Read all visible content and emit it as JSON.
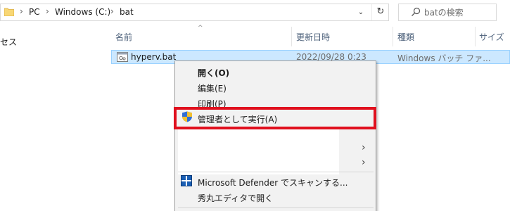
{
  "address_bar": {
    "breadcrumbs": [
      "PC",
      "Windows (C:)",
      "bat"
    ],
    "separator": "›",
    "dropdown_glyph": "⌄",
    "refresh_glyph": "↻"
  },
  "search": {
    "placeholder": "batの検索"
  },
  "nav_pane": {
    "partial_label": "セス"
  },
  "columns": {
    "name": "名前",
    "modified": "更新日時",
    "type": "種類",
    "size": "サイズ",
    "sort_glyph": "^"
  },
  "files": [
    {
      "name": "hyperv.bat",
      "modified": "2022/09/28 0:23",
      "type": "Windows バッチ ファ..."
    }
  ],
  "context_menu": {
    "open": "開く(O)",
    "edit": "編集(E)",
    "print": "印刷(P)",
    "run_as_admin": "管理者として実行(A)",
    "submenu_glyph": "›",
    "defender_scan": "Microsoft Defender でスキャンする...",
    "open_hidemaru": "秀丸エディタで開く"
  },
  "colors": {
    "selection_bg": "#cce8ff",
    "selection_border": "#99d1ff",
    "highlight_border": "#e0101e",
    "menu_bg": "#f2f2f2",
    "folder_yellow": "#f8d775"
  },
  "icons": [
    "folder-icon",
    "search-icon",
    "refresh-icon",
    "batch-file-icon",
    "uac-shield-icon",
    "defender-icon"
  ]
}
